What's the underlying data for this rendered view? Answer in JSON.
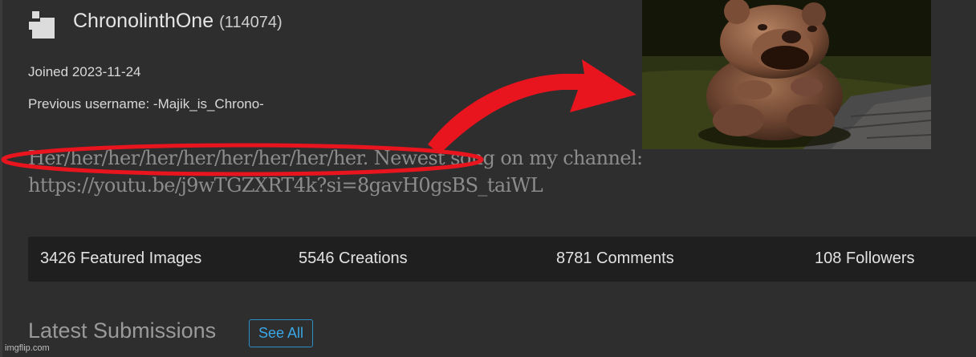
{
  "profile": {
    "username": "ChronolinthOne",
    "points": "(114074)",
    "joined": "Joined 2023-11-24",
    "previous_username": "Previous username: -Majik_is_Chrono-",
    "bio_line1": "Her/her/her/her/her/her/her/her/her. Newest song on my channel:",
    "bio_line2": "https://youtu.be/j9wTGZXRT4k?si=8gavH0gsBS_taiWL"
  },
  "stats": {
    "featured": "3426 Featured Images",
    "creations": "5546 Creations",
    "comments": "8781 Comments",
    "followers": "108 Followers"
  },
  "latest": {
    "title": "Latest Submissions",
    "see_all": "See All"
  },
  "watermark": "imgflip.com",
  "colors": {
    "background": "#2e2e2f",
    "stats_bar": "#1f1f20",
    "accent": "#3aa7e6",
    "annotation_red": "#e8141e"
  },
  "icons": [
    "avatar-icon",
    "red-arrow-annotation",
    "red-ellipse-annotation"
  ],
  "image": {
    "subject": "bear-statue-photo"
  }
}
